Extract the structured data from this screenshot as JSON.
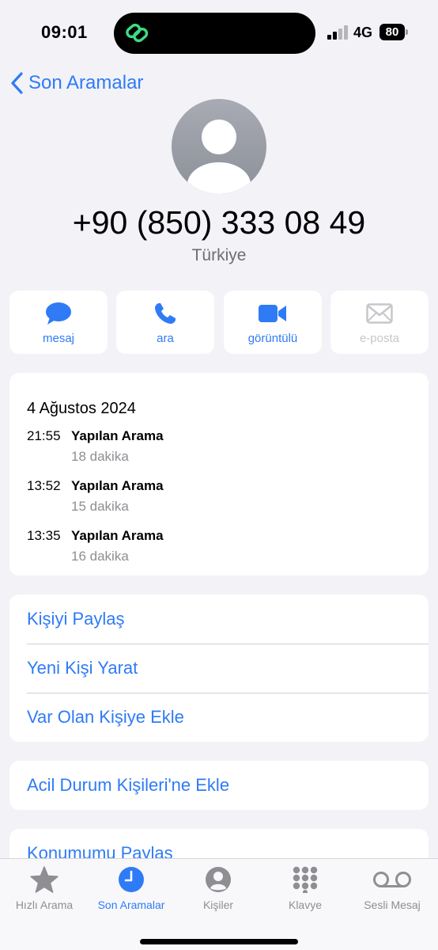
{
  "status_bar": {
    "time": "09:01",
    "network": "4G",
    "battery": "80",
    "signal_bars_active": 2
  },
  "nav": {
    "back_label": "Son Aramalar"
  },
  "contact": {
    "phone_number": "+90 (850) 333 08 49",
    "country": "Türkiye"
  },
  "actions": [
    {
      "label": "mesaj",
      "icon": "message-icon",
      "enabled": true
    },
    {
      "label": "ara",
      "icon": "phone-icon",
      "enabled": true
    },
    {
      "label": "görüntülü",
      "icon": "video-icon",
      "enabled": true
    },
    {
      "label": "e-posta",
      "icon": "mail-icon",
      "enabled": false
    }
  ],
  "call_log": {
    "date": "4 Ağustos 2024",
    "entries": [
      {
        "time": "21:55",
        "type": "Yapılan Arama",
        "duration": "18 dakika"
      },
      {
        "time": "13:52",
        "type": "Yapılan Arama",
        "duration": "15 dakika"
      },
      {
        "time": "13:35",
        "type": "Yapılan Arama",
        "duration": "16 dakika"
      }
    ]
  },
  "options": {
    "share_contact": "Kişiyi Paylaş",
    "create_contact": "Yeni Kişi Yarat",
    "add_to_existing": "Var Olan Kişiye Ekle",
    "add_emergency": "Acil Durum Kişileri'ne Ekle",
    "share_location": "Konumumu Paylaş"
  },
  "tabbar": {
    "items": [
      {
        "label": "Hızlı Arama",
        "icon": "star-icon",
        "active": false
      },
      {
        "label": "Son Aramalar",
        "icon": "clock-icon",
        "active": true
      },
      {
        "label": "Kişiler",
        "icon": "person-icon",
        "active": false
      },
      {
        "label": "Klavye",
        "icon": "keypad-icon",
        "active": false
      },
      {
        "label": "Sesli Mesaj",
        "icon": "voicemail-icon",
        "active": false
      }
    ]
  },
  "colors": {
    "accent": "#2f7bf6",
    "background": "#f2f2f7",
    "card": "#ffffff",
    "secondary_text": "#8e8e93",
    "disabled": "#c7c7cc"
  }
}
